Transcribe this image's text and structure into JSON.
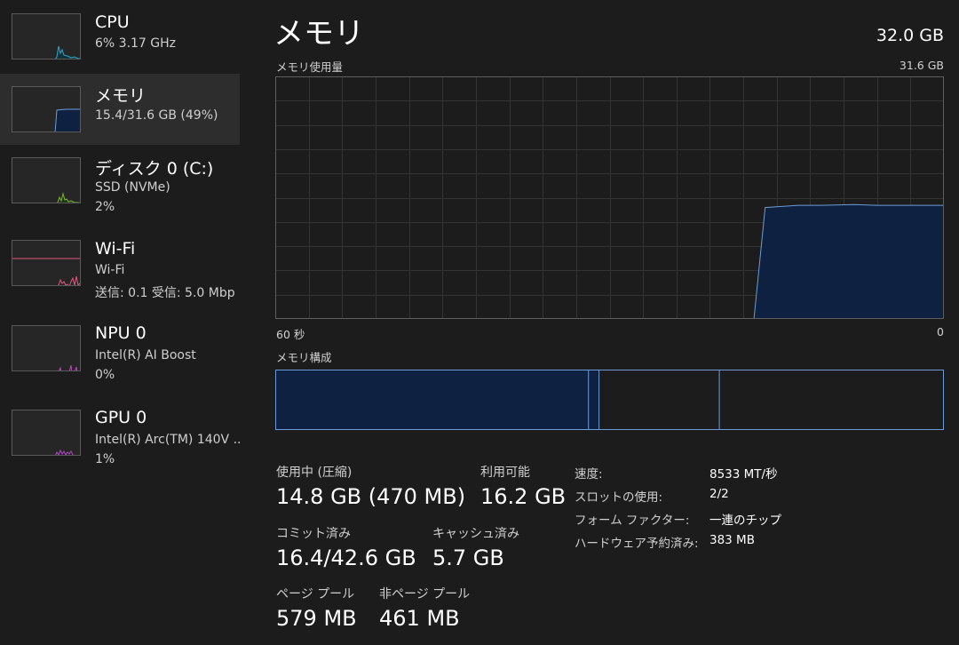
{
  "colors": {
    "background": "#1c1c1c",
    "sidebar_selected": "#2d2d2d",
    "memory_accent": "#6e9bd8",
    "memory_fill": "#0f2140",
    "cpu_accent": "#30a8c8",
    "disk_accent": "#7ab830",
    "wifi_accent": "#e0567f",
    "npu_accent": "#b04cb0",
    "gpu_accent": "#b04cc0",
    "grid": "#333333"
  },
  "sidebar": {
    "items": [
      {
        "title": "CPU",
        "sub1": "6%  3.17 GHz",
        "sub2": "",
        "icon": "cpu-thumbnail-graph"
      },
      {
        "title": "メモリ",
        "sub1": "15.4/31.6 GB (49%)",
        "sub2": "",
        "icon": "memory-thumbnail-graph"
      },
      {
        "title": "ディスク 0 (C:)",
        "sub1": "SSD (NVMe)",
        "sub2": "2%",
        "icon": "disk-thumbnail-graph"
      },
      {
        "title": "Wi-Fi",
        "sub1": "Wi-Fi",
        "sub2": "送信: 0.1  受信: 5.0 Mbp",
        "icon": "wifi-thumbnail-graph"
      },
      {
        "title": "NPU 0",
        "sub1": "Intel(R) AI Boost",
        "sub2": "0%",
        "icon": "npu-thumbnail-graph"
      },
      {
        "title": "GPU 0",
        "sub1": "Intel(R) Arc(TM) 140V ...",
        "sub2": "1%",
        "icon": "gpu-thumbnail-graph"
      }
    ]
  },
  "header": {
    "title": "メモリ",
    "total": "32.0 GB"
  },
  "usage_graph": {
    "label": "メモリ使用量",
    "max_label": "31.6 GB",
    "x_left_label": "60 秒",
    "x_right_label": "0"
  },
  "chart_data": {
    "type": "area",
    "title": "メモリ使用量",
    "xlabel": "",
    "ylabel": "",
    "x": [
      60,
      56,
      53,
      49,
      45,
      41,
      38,
      34,
      30,
      26,
      23,
      19,
      17,
      16,
      15,
      13,
      11,
      8,
      6,
      4,
      2,
      0
    ],
    "values": [
      null,
      null,
      null,
      null,
      null,
      null,
      null,
      null,
      null,
      null,
      null,
      null,
      0,
      14.5,
      14.6,
      14.8,
      14.8,
      14.9,
      14.8,
      14.8,
      14.8,
      14.8
    ],
    "xlim": [
      60,
      0
    ],
    "ylim": [
      0,
      31.6
    ],
    "grid": true
  },
  "composition": {
    "label": "メモリ構成",
    "segments_gb": {
      "in_use": 14.8,
      "modified": 0.5,
      "standby": 5.7,
      "free": 10.6
    },
    "total_gb": 31.6
  },
  "stats": {
    "in_use_label": "使用中 (圧縮)",
    "in_use_value": "14.8 GB (470 MB)",
    "available_label": "利用可能",
    "available_value": "16.2 GB",
    "committed_label": "コミット済み",
    "committed_value": "16.4/42.6 GB",
    "cached_label": "キャッシュ済み",
    "cached_value": "5.7 GB",
    "paged_label": "ページ プール",
    "paged_value": "579 MB",
    "nonpaged_label": "非ページ プール",
    "nonpaged_value": "461 MB"
  },
  "details": {
    "speed_label": "速度:",
    "speed_value": "8533 MT/秒",
    "slots_label": "スロットの使用:",
    "slots_value": "2/2",
    "form_label": "フォーム ファクター:",
    "form_value": "一連のチップ",
    "reserved_label": "ハードウェア予約済み:",
    "reserved_value": "383 MB"
  }
}
